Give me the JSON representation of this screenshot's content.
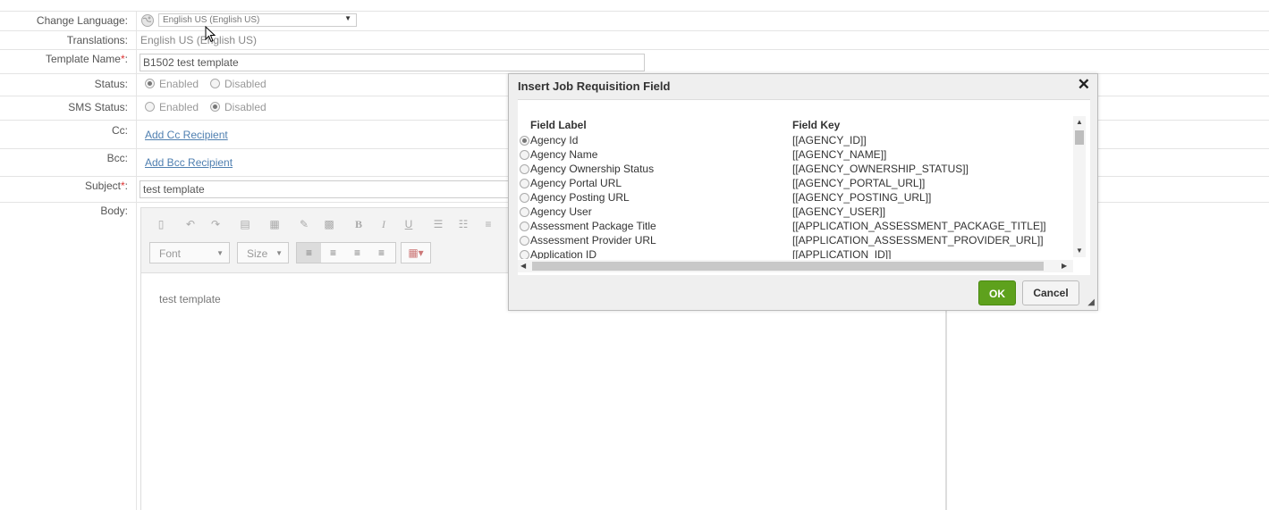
{
  "form": {
    "change_language_label": "Change Language:",
    "language_value": "English US (English US)",
    "translations_label": "Translations:",
    "translations_value": "English US (English US)",
    "template_name_label": "Template Name",
    "template_name_value": "B1502 test template",
    "required_mark": "*",
    "colon": ":",
    "status_label": "Status:",
    "status_options": [
      "Enabled",
      "Disabled"
    ],
    "sms_status_label": "SMS Status:",
    "sms_status_options": [
      "Enabled",
      "Disabled"
    ],
    "cc_label": "Cc:",
    "add_cc_link": "Add Cc Recipient",
    "bcc_label": "Bcc:",
    "add_bcc_link": "Add Bcc Recipient",
    "subject_label": "Subject",
    "subject_value": "test template",
    "body_label": "Body:"
  },
  "editor": {
    "font_label": "Font",
    "size_label": "Size",
    "bold": "B",
    "italic": "I",
    "underline": "U",
    "body_text": "test template"
  },
  "dialog": {
    "title": "Insert Job Requisition Field",
    "col_label": "Field Label",
    "col_key": "Field Key",
    "rows": [
      {
        "label": "Agency Id",
        "key": "[[AGENCY_ID]]"
      },
      {
        "label": "Agency Name",
        "key": "[[AGENCY_NAME]]"
      },
      {
        "label": "Agency Ownership Status",
        "key": "[[AGENCY_OWNERSHIP_STATUS]]"
      },
      {
        "label": "Agency Portal URL",
        "key": "[[AGENCY_PORTAL_URL]]"
      },
      {
        "label": "Agency Posting URL",
        "key": "[[AGENCY_POSTING_URL]]"
      },
      {
        "label": "Agency User",
        "key": "[[AGENCY_USER]]"
      },
      {
        "label": "Assessment Package Title",
        "key": "[[APPLICATION_ASSESSMENT_PACKAGE_TITLE]]"
      },
      {
        "label": "Assessment Provider URL",
        "key": "[[APPLICATION_ASSESSMENT_PROVIDER_URL]]"
      },
      {
        "label": "Application ID",
        "key": "[[APPLICATION_ID]]"
      }
    ],
    "ok_label": "OK",
    "cancel_label": "Cancel"
  }
}
